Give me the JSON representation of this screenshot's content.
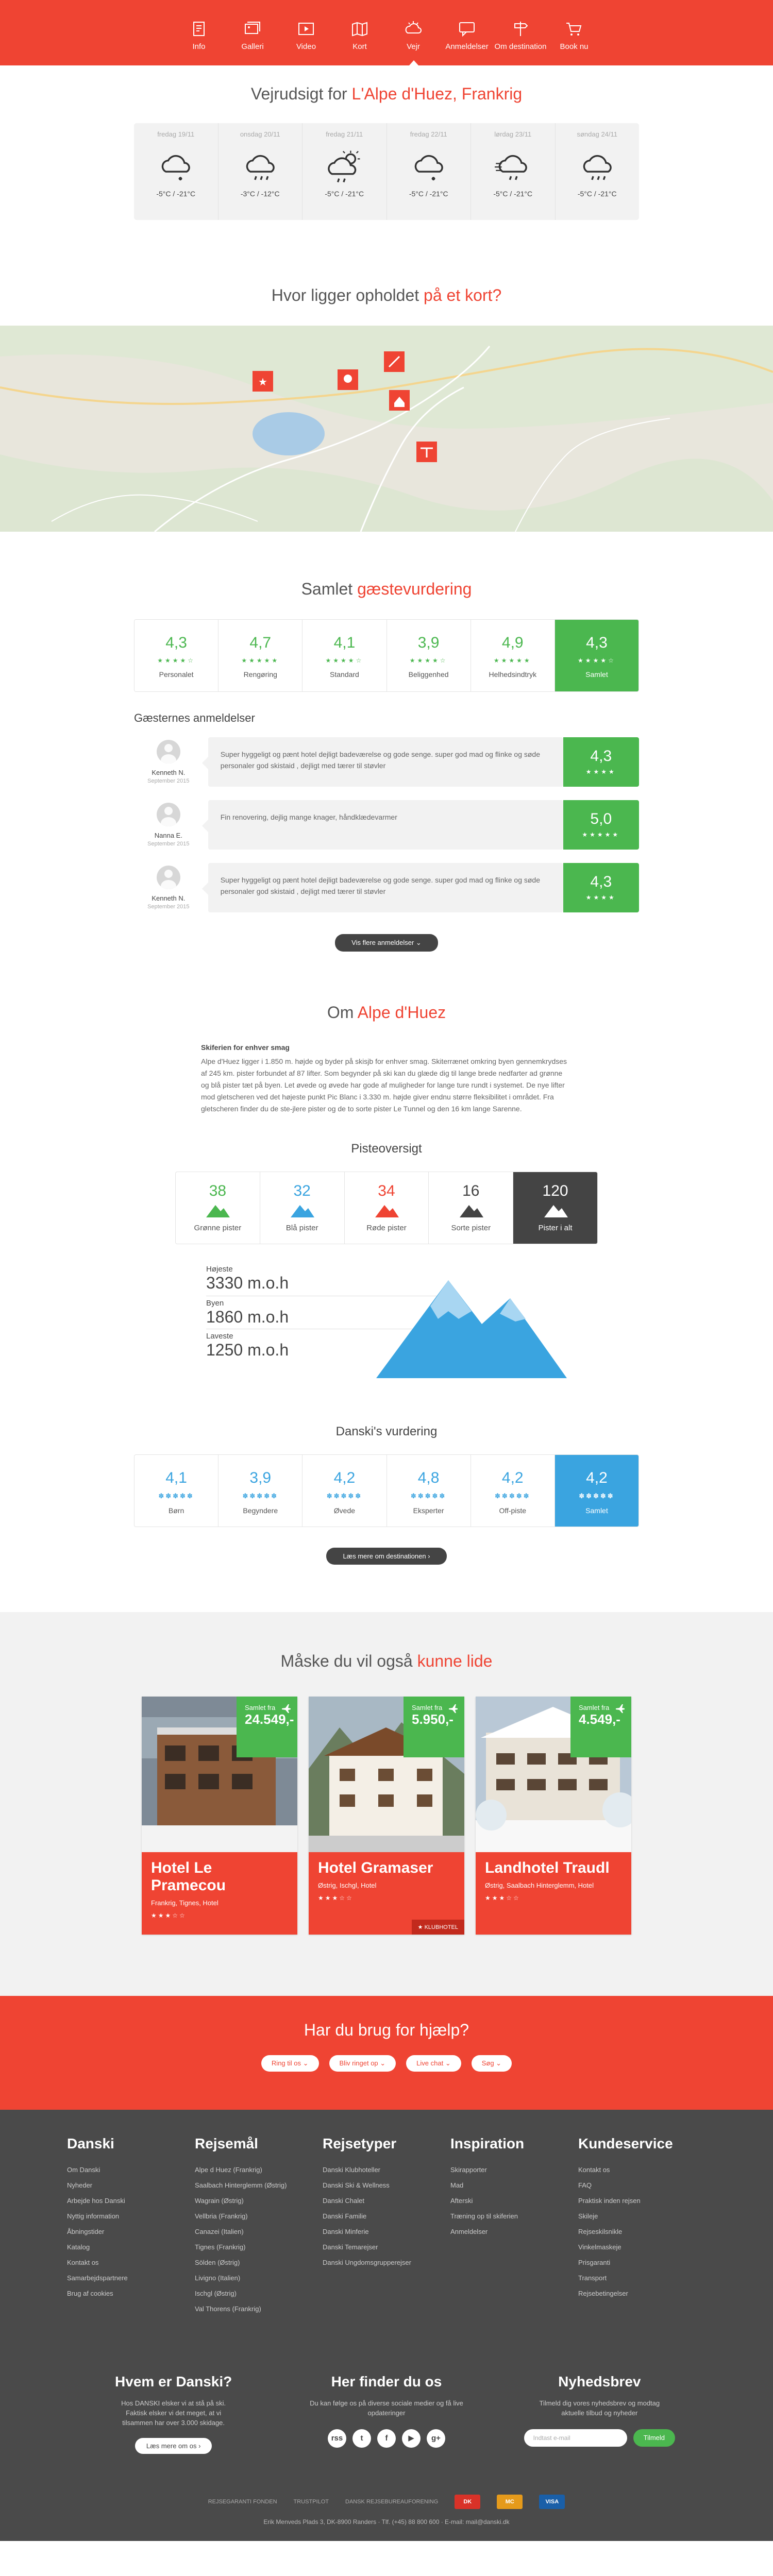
{
  "nav": {
    "items": [
      {
        "label": "Info",
        "icon": "info-book-icon"
      },
      {
        "label": "Galleri",
        "icon": "gallery-icon"
      },
      {
        "label": "Video",
        "icon": "video-icon"
      },
      {
        "label": "Kort",
        "icon": "map-icon"
      },
      {
        "label": "Vejr",
        "icon": "weather-icon",
        "active": true
      },
      {
        "label": "Anmeldelser",
        "icon": "chat-icon"
      },
      {
        "label": "Om destination",
        "icon": "signpost-icon"
      },
      {
        "label": "Book nu",
        "icon": "cart-icon"
      }
    ]
  },
  "weather": {
    "title_pre": "Vejrudsigt for",
    "title_hl": "L'Alpe d'Huez, Frankrig",
    "days": [
      {
        "day": "fredag 19/11",
        "temp": "-5°C / -21°C",
        "icon": "cloud-snow-icon"
      },
      {
        "day": "onsdag 20/11",
        "temp": "-3°C / -12°C",
        "icon": "cloud-rain-icon"
      },
      {
        "day": "fredag 21/11",
        "temp": "-5°C / -21°C",
        "icon": "sun-cloud-rain-icon"
      },
      {
        "day": "fredag 22/11",
        "temp": "-5°C / -21°C",
        "icon": "cloud-snow-icon"
      },
      {
        "day": "lørdag 23/11",
        "temp": "-5°C / -21°C",
        "icon": "wind-cloud-rain-icon"
      },
      {
        "day": "søndag 24/11",
        "temp": "-5°C / -21°C",
        "icon": "cloud-rain-icon"
      }
    ]
  },
  "map": {
    "title_pre": "Hvor ligger opholdet",
    "title_hl": "på et kort?"
  },
  "reviews": {
    "title_pre": "Samlet",
    "title_hl": "gæstevurdering",
    "scores": [
      {
        "value": "4,3",
        "label": "Personalet"
      },
      {
        "value": "4,7",
        "label": "Rengøring"
      },
      {
        "value": "4,1",
        "label": "Standard"
      },
      {
        "value": "3,9",
        "label": "Beliggenhed"
      },
      {
        "value": "4,9",
        "label": "Helhedsindtryk"
      },
      {
        "value": "4,3",
        "label": "Samlet"
      }
    ],
    "guest_title": "Gæsternes anmeldelser",
    "list": [
      {
        "name": "Kenneth N.",
        "date": "September 2015",
        "text": "Super hyggeligt og pænt hotel dejligt badeværelse og gode senge. super god mad og flinke og søde personaler god skistaid , dejligt med tærer til støvler",
        "score": "4,3",
        "stars": "★★★★"
      },
      {
        "name": "Nanna E.",
        "date": "September 2015",
        "text": "Fin renovering, dejlig mange knager, håndklædevarmer",
        "score": "5,0",
        "stars": "★★★★★"
      },
      {
        "name": "Kenneth N.",
        "date": "September 2015",
        "text": "Super hyggeligt og pænt hotel dejligt badeværelse og gode senge. super god mad og flinke og søde personaler god skistaid , dejligt med tærer til støvler",
        "score": "4,3",
        "stars": "★★★★"
      }
    ],
    "more_btn": "Vis flere anmeldelser ⌄"
  },
  "about": {
    "title_pre": "Om",
    "title_hl": "Alpe d'Huez",
    "heading": "Skiferien for enhver smag",
    "body": "Alpe d'Huez ligger i 1.850 m. højde og byder på skisjb for enhver smag. Skiterrænet omkring byen gennemkrydses af 245 km. pister forbundet af 87 lifter. Som begynder på ski kan du glæde dig til lange brede nedfarter ad grønne og blå pister tæt på byen. Let øvede og øvede har gode af muligheder for lange ture rundt i systemet. De nye lifter mod gletscheren ved det højeste punkt Pic Blanc i 3.330 m. højde giver endnu større fleksibilitet i området. Fra gletscheren finder du de ste-jlere pister og de to sorte pister Le Tunnel og den 16 km lange Sarenne.",
    "piste_title": "Pisteoversigt",
    "pistes": [
      {
        "value": "38",
        "label": "Grønne pister",
        "color": "#4bb74f"
      },
      {
        "value": "32",
        "label": "Blå pister",
        "color": "#3aa4e0"
      },
      {
        "value": "34",
        "label": "Røde pister",
        "color": "#ef4433"
      },
      {
        "value": "16",
        "label": "Sorte pister",
        "color": "#444444"
      },
      {
        "value": "120",
        "label": "Pister i alt",
        "color": "#ffffff"
      }
    ],
    "altitude": {
      "high_k": "Højeste",
      "high_v": "3330 m.o.h",
      "town_k": "Byen",
      "town_v": "1860 m.o.h",
      "low_k": "Laveste",
      "low_v": "1250 m.o.h"
    },
    "rating_title": "Danski's vurdering",
    "ratings": [
      {
        "value": "4,1",
        "label": "Børn"
      },
      {
        "value": "3,9",
        "label": "Begyndere"
      },
      {
        "value": "4,2",
        "label": "Øvede"
      },
      {
        "value": "4,8",
        "label": "Eksperter"
      },
      {
        "value": "4,2",
        "label": "Off-piste"
      },
      {
        "value": "4,2",
        "label": "Samlet"
      }
    ],
    "more_btn": "Læs mere om destinationen ›"
  },
  "like": {
    "title_pre": "Måske du vil også",
    "title_hl": "kunne lide",
    "cards": [
      {
        "price_pre": "Samlet fra",
        "price": "24.549,-",
        "name": "Hotel Le Pramecou",
        "loc": "Frankrig, Tignes, Hotel",
        "stars": "★★★☆☆"
      },
      {
        "price_pre": "Samlet fra",
        "price": "5.950,-",
        "name": "Hotel Gramaser",
        "loc": "Østrig, Ischgl, Hotel",
        "stars": "★★★☆☆",
        "badge": "★ KLUBHOTEL"
      },
      {
        "price_pre": "Samlet fra",
        "price": "4.549,-",
        "name": "Landhotel Traudl",
        "loc": "Østrig, Saalbach Hinterglemm, Hotel",
        "stars": "★★★☆☆"
      }
    ]
  },
  "help": {
    "title": "Har du brug for hjælp?",
    "buttons": [
      "Ring til os ⌄",
      "Bliv ringet op ⌄",
      "Live chat ⌄",
      "Søg ⌄"
    ]
  },
  "footer": {
    "cols": [
      {
        "title": "Danski",
        "items": [
          "Om Danski",
          "Nyheder",
          "Arbejde hos Danski",
          "Nyttig information",
          "Åbningstider",
          "Katalog",
          "Kontakt os",
          "Samarbejdspartnere",
          "Brug af cookies"
        ]
      },
      {
        "title": "Rejsemål",
        "items": [
          "Alpe d Huez (Frankrig)",
          "Saalbach Hinterglemm (Østrig)",
          "Wagrain (Østrig)",
          "Vellbria (Frankrig)",
          "Canazei (Italien)",
          "Tignes (Frankrig)",
          "Sölden (Østrig)",
          "Livigno (Italien)",
          "Ischgl (Østrig)",
          "Val Thorens (Frankrig)"
        ]
      },
      {
        "title": "Rejsetyper",
        "items": [
          "Danski Klubhoteller",
          "Danski Ski & Wellness",
          "Danski Chalet",
          "Danski Familie",
          "Danski Minferie",
          "Danski Temarejser",
          "Danski Ungdomsgrupperejser"
        ]
      },
      {
        "title": "Inspiration",
        "items": [
          "Skirapporter",
          "Mad",
          "Afterski",
          "Træning op til skiferien",
          "Anmeldelser"
        ]
      },
      {
        "title": "Kundeservice",
        "items": [
          "Kontakt os",
          "FAQ",
          "Praktisk inden rejsen",
          "Skileje",
          "Rejseskilsnikle",
          "Vinkelmaskeje",
          "Prisgaranti",
          "Transport",
          "Rejsebetingelser"
        ]
      }
    ],
    "who": {
      "title": "Hvem er Danski?",
      "text": "Hos DANSKI elsker vi at stå på ski. Faktisk elsker vi det meget, at vi tilsammen har over 3.000 skidage.",
      "btn": "Læs mere om os ›"
    },
    "where": {
      "title": "Her finder du os",
      "text": "Du kan følge os på diverse sociale medier og få live opdateringer"
    },
    "social": [
      "rss",
      "t",
      "f",
      "▶",
      "g+"
    ],
    "news": {
      "title": "Nyhedsbrev",
      "text": "Tilmeld dig vores nyhedsbrev og modtag aktuelle tilbud og nyheder",
      "placeholder": "Indtast e-mail",
      "btn": "Tilmeld"
    },
    "logos": [
      "REJSEGARANTI FONDEN",
      "TRUSTPILOT",
      "DANSK REJSEBUREAUFORENING"
    ],
    "payments": [
      "DK",
      "MC",
      "VISA"
    ],
    "address": "Erik Menveds Plads 3, DK-8900 Randers · Tlf. (+45) 88 800 600 · E-mail: mail@danski.dk"
  }
}
